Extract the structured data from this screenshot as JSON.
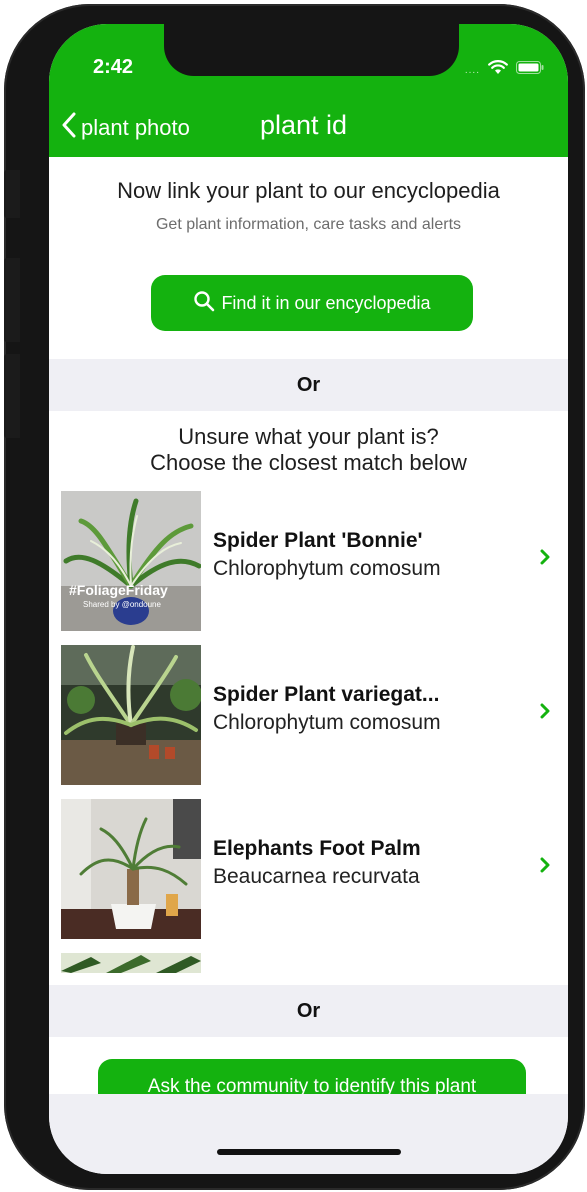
{
  "status_bar": {
    "time": "2:42",
    "dots": "....",
    "icons": [
      "wifi-icon",
      "battery-icon"
    ]
  },
  "nav": {
    "back_label": "plant photo",
    "title": "plant id"
  },
  "encyclopedia": {
    "title": "Now link your plant to our encyclopedia",
    "subtitle": "Get plant information, care tasks and alerts",
    "button_label": "Find it in our encyclopedia"
  },
  "or_labels": [
    "Or",
    "Or"
  ],
  "matches": {
    "heading_line1": "Unsure what your plant is?",
    "heading_line2": "Choose the closest match below",
    "items": [
      {
        "name": "Spider Plant 'Bonnie'",
        "scientific": "Chlorophytum comosum",
        "thumb_caption": "#FoliageFriday",
        "thumb_subcaption": "Shared by @ondoune"
      },
      {
        "name": "Spider Plant variegat...",
        "scientific": "Chlorophytum comosum"
      },
      {
        "name": "Elephants Foot Palm",
        "scientific": "Beaucarnea recurvata"
      }
    ]
  },
  "community": {
    "button_label": "Ask the community to identify this plant"
  },
  "colors": {
    "accent": "#14b20f",
    "band": "#efeff4"
  }
}
